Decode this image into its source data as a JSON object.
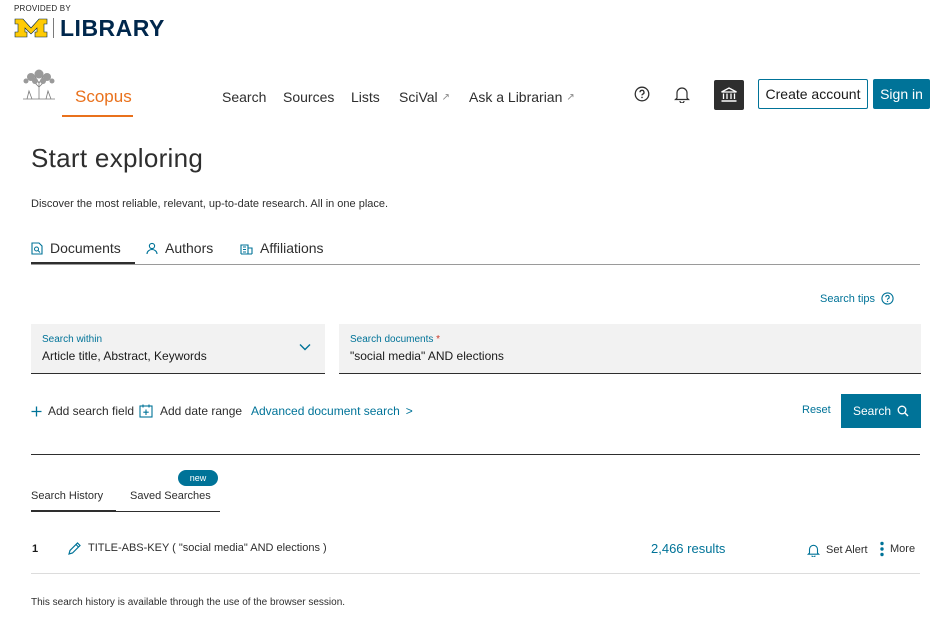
{
  "library_brand": {
    "provided_by": "PROVIDED BY",
    "name": "LIBRARY"
  },
  "header": {
    "brand_name": "Scopus",
    "nav": [
      {
        "label": "Search",
        "external": false
      },
      {
        "label": "Sources",
        "external": false
      },
      {
        "label": "Lists",
        "external": false
      },
      {
        "label": "SciVal",
        "external": true
      },
      {
        "label": "Ask a Librarian",
        "external": true
      }
    ],
    "external_marker": "↗",
    "create_account": "Create account",
    "sign_in": "Sign in",
    "icons": [
      "help-icon",
      "bell-icon",
      "institution-icon"
    ]
  },
  "page": {
    "title": "Start exploring",
    "intro": "Discover the most reliable, relevant, up-to-date research. All in one place."
  },
  "tabs": [
    {
      "label": "Documents",
      "icon": "document-search-icon",
      "active": true
    },
    {
      "label": "Authors",
      "icon": "person-icon",
      "active": false
    },
    {
      "label": "Affiliations",
      "icon": "building-icon",
      "active": false
    }
  ],
  "search": {
    "tips_label": "Search tips",
    "within_label": "Search within",
    "within_value": "Article title, Abstract, Keywords",
    "docs_label": "Search documents",
    "required_marker": "*",
    "docs_value": "\"social media\" AND elections",
    "add_field": "Add search field",
    "add_date": "Add date range",
    "advanced": "Advanced document search",
    "advanced_chevron": ">",
    "reset": "Reset",
    "search_button": "Search"
  },
  "history": {
    "tabs": [
      {
        "label": "Search History",
        "active": true
      },
      {
        "label": "Saved Searches",
        "active": false
      }
    ],
    "new_badge": "new",
    "rows": [
      {
        "number": "1",
        "query": "TITLE-ABS-KEY ( \"social media\" AND elections )",
        "results": "2,466 results",
        "alert": "Set Alert",
        "more": "More"
      }
    ],
    "note": "This search history is available through the use of the browser session."
  },
  "colors": {
    "accent": "#007398",
    "brand_orange": "#e9711c",
    "michigan_blue": "#00274c",
    "michigan_maize": "#ffcb05",
    "required": "#c83727"
  }
}
